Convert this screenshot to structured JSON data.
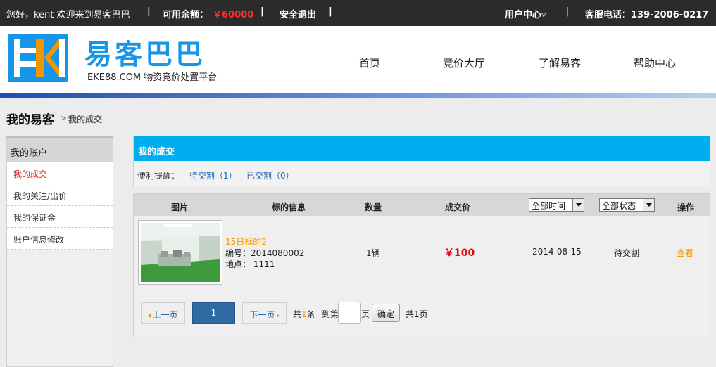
{
  "topbar": {
    "greeting": "您好，kent 欢迎来到易客巴巴",
    "balance_label": "可用余额：",
    "balance_value": "￥60000",
    "logout": "安全退出",
    "user_center": "用户中心▿",
    "service_phone": "客服电话：139-2006-0217",
    "separator": "|"
  },
  "header": {
    "logo_cn": "易客巴巴",
    "logo_en": "EKE88.COM 物资竞价处置平台",
    "nav": [
      "首页",
      "竞价大厅",
      "了解易客",
      "帮助中心"
    ]
  },
  "breadcrumb": {
    "main": "我的易客",
    "sep": ">",
    "sub": "我的成交"
  },
  "sidebar": {
    "heading": "我的账户",
    "items": [
      "我的成交",
      "我的关注/出价",
      "我的保证金",
      "账户信息修改"
    ]
  },
  "panel": {
    "title": "我的成交",
    "reminder_label": "便利提醒：",
    "pending": "待交割（1）",
    "done": "已交割（0）"
  },
  "table": {
    "headers": [
      "图片",
      "标的信息",
      "数量",
      "成交价",
      "操作"
    ],
    "time_filter": "全部时间",
    "status_filter": "全部状态",
    "rows": [
      {
        "title": "15日标的2",
        "number": "编号：2014080002",
        "location": "地点： 1111",
        "quantity": "1辆",
        "price": "￥100",
        "date": "2014-08-15",
        "status": "待交割",
        "action": "查看"
      }
    ]
  },
  "pager": {
    "prev": "上一页",
    "current": "1",
    "next": "下一页",
    "total_prefix": "共",
    "total_count": "1",
    "total_suffix": "条",
    "goto_prefix": "到第",
    "goto_suffix": "页",
    "ok": "确定",
    "total_pages": "共1页"
  },
  "colors": {
    "accent_blue": "#00aeef",
    "logo_blue": "#1796e8",
    "logo_orange": "#f29600",
    "price_red": "#e60012"
  }
}
